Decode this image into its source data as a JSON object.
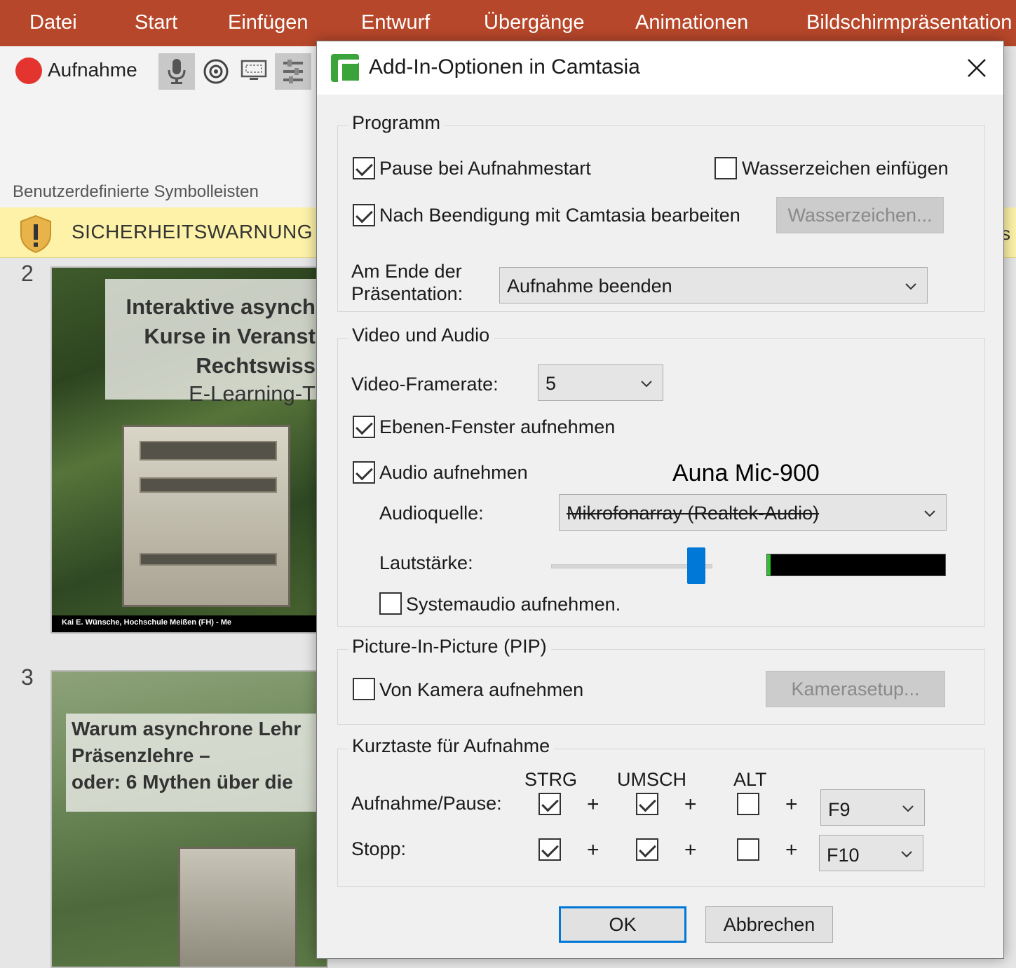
{
  "ribbon": {
    "tabs": [
      "Datei",
      "Start",
      "Einfügen",
      "Entwurf",
      "Übergänge",
      "Animationen",
      "Bildschirmpräsentation"
    ],
    "record_label": "Aufnahme",
    "group_label": "Benutzerdefinierte Symbolleisten"
  },
  "warning": {
    "label": "SICHERHEITSWARNUNG",
    "trailing": "s"
  },
  "slides": [
    {
      "number": "2",
      "title_lines": [
        "Interaktive asynch",
        "Kurse in Veranst",
        "Rechtswiss",
        "E-Learning-T"
      ],
      "footer": "Kai E. Wünsche, Hochschule Meißen (FH)      -      Me"
    },
    {
      "number": "3",
      "title_lines": [
        "Warum asynchrone Lehr",
        "Präsenzlehre –",
        "oder: 6 Mythen über die"
      ]
    }
  ],
  "dialog": {
    "title": "Add-In-Optionen in Camtasia",
    "programm": {
      "label": "Programm",
      "pause_on_start": {
        "label": "Pause bei Aufnahmestart",
        "checked": true
      },
      "watermark": {
        "label": "Wasserzeichen einfügen",
        "checked": false
      },
      "edit_after": {
        "label": "Nach Beendigung mit Camtasia bearbeiten",
        "checked": true
      },
      "watermark_button": "Wasserzeichen...",
      "end_label_1": "Am Ende der",
      "end_label_2": "Präsentation:",
      "end_value": "Aufnahme beenden"
    },
    "video_audio": {
      "label": "Video und Audio",
      "framerate_label": "Video-Framerate:",
      "framerate_value": "5",
      "layered": {
        "label": "Ebenen-Fenster aufnehmen",
        "checked": true
      },
      "audio": {
        "label": "Audio aufnehmen",
        "checked": true
      },
      "annotation": "Auna Mic-900",
      "source_label": "Audioquelle:",
      "source_value": "Mikrofonarray (Realtek-Audio)",
      "volume_label": "Lautstärke:",
      "volume_level": 0.9,
      "meter_level": 0.02,
      "system_audio": {
        "label": "Systemaudio aufnehmen.",
        "checked": false
      }
    },
    "pip": {
      "label": "Picture-In-Picture (PIP)",
      "camera": {
        "label": "Von Kamera aufnehmen",
        "checked": false
      },
      "camera_button": "Kamerasetup..."
    },
    "hotkeys": {
      "label": "Kurztaste für Aufnahme",
      "col_ctrl": "STRG",
      "col_shift": "UMSCH",
      "col_alt": "ALT",
      "plus": "+",
      "rows": [
        {
          "label": "Aufnahme/Pause:",
          "ctrl": true,
          "shift": true,
          "alt": false,
          "key": "F9"
        },
        {
          "label": "Stopp:",
          "ctrl": true,
          "shift": true,
          "alt": false,
          "key": "F10"
        }
      ]
    },
    "ok": "OK",
    "cancel": "Abbrechen"
  }
}
